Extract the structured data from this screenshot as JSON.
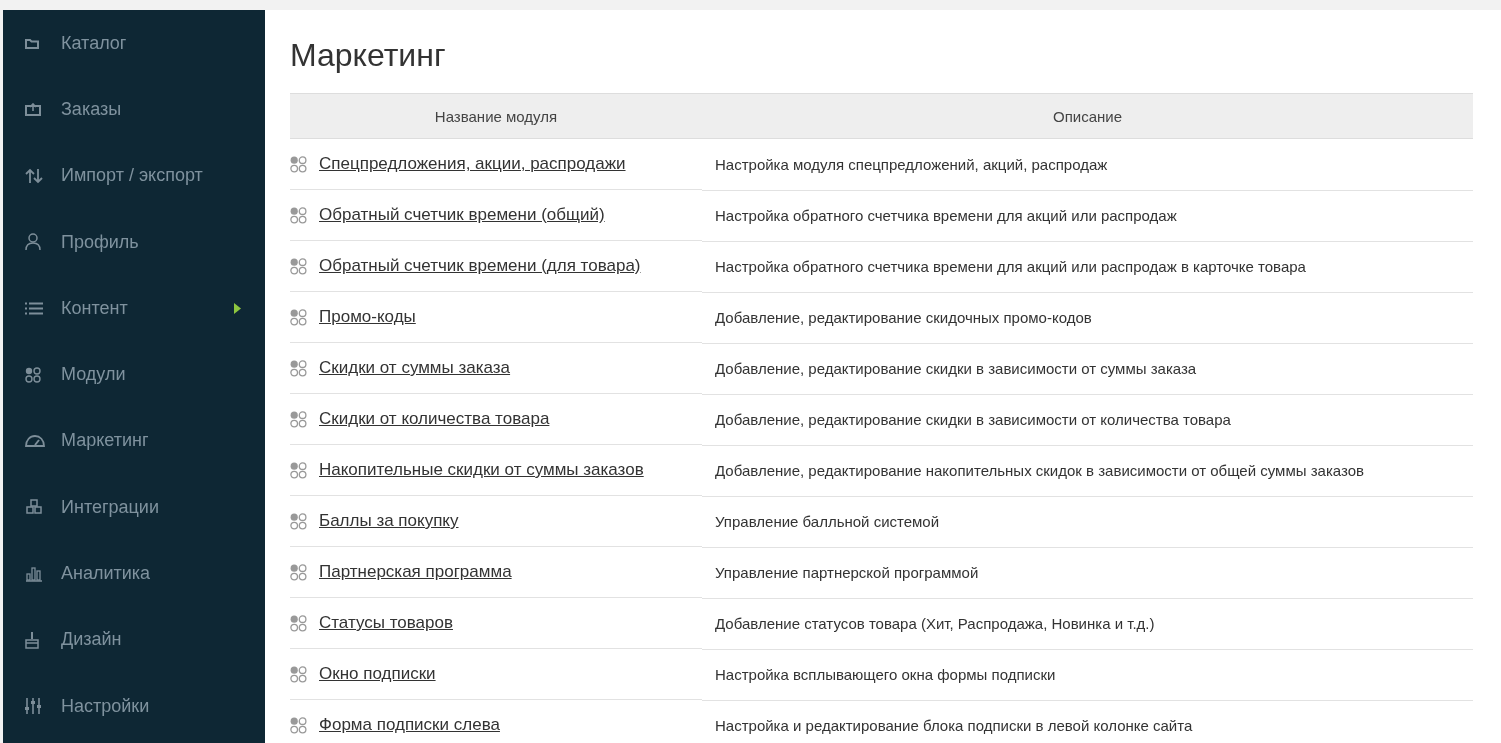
{
  "sidebar": {
    "items": [
      {
        "label": "Каталог",
        "has_submenu": false
      },
      {
        "label": "Заказы",
        "has_submenu": false
      },
      {
        "label": "Импорт / экспорт",
        "has_submenu": false
      },
      {
        "label": "Профиль",
        "has_submenu": false
      },
      {
        "label": "Контент",
        "has_submenu": true
      },
      {
        "label": "Модули",
        "has_submenu": false
      },
      {
        "label": "Маркетинг",
        "has_submenu": false
      },
      {
        "label": "Интеграции",
        "has_submenu": false
      },
      {
        "label": "Аналитика",
        "has_submenu": false
      },
      {
        "label": "Дизайн",
        "has_submenu": false
      },
      {
        "label": "Настройки",
        "has_submenu": false
      }
    ]
  },
  "page": {
    "title": "Маркетинг"
  },
  "table": {
    "columns": [
      "Название модуля",
      "Описание"
    ],
    "rows": [
      {
        "name": "Спецпредложения, акции, распродажи",
        "description": "Настройка модуля спецпредложений, акций, распродаж"
      },
      {
        "name": "Обратный счетчик времени (общий)",
        "description": "Настройка обратного счетчика времени для акций или распродаж"
      },
      {
        "name": "Обратный счетчик времени (для товара)",
        "description": "Настройка обратного счетчика времени для акций или распродаж в карточке товара"
      },
      {
        "name": "Промо-коды",
        "description": "Добавление, редактирование скидочных промо-кодов"
      },
      {
        "name": "Скидки от суммы заказа",
        "description": "Добавление, редактирование скидки в зависимости от суммы заказа"
      },
      {
        "name": "Скидки от количества товара",
        "description": "Добавление, редактирование скидки в зависимости от количества товара"
      },
      {
        "name": "Накопительные скидки от суммы заказов",
        "description": "Добавление, редактирование накопительных скидок в зависимости от общей суммы заказов"
      },
      {
        "name": "Баллы за покупку",
        "description": "Управление балльной системой"
      },
      {
        "name": "Партнерская программа",
        "description": "Управление партнерской программой"
      },
      {
        "name": "Статусы товаров",
        "description": "Добавление статусов товара (Хит, Распродажа, Новинка и т.д.)"
      },
      {
        "name": "Окно подписки",
        "description": "Настройка всплывающего окна формы подписки"
      },
      {
        "name": "Форма подписки слева",
        "description": "Настройка и редактирование блока подписки в левой колонке сайта"
      }
    ]
  }
}
